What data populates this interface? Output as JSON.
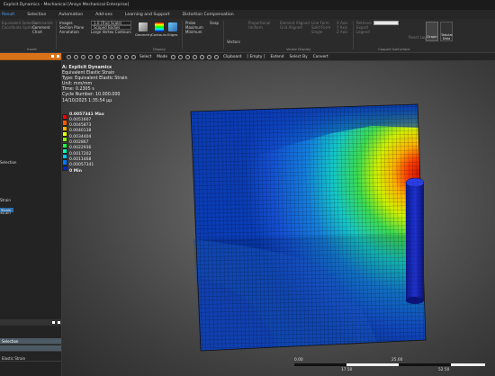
{
  "window": {
    "title": "Explicit Dynamics - Mechanical [Ansys Mechanical Enterprise]"
  },
  "menu": [
    "Result",
    "Selection",
    "Automation",
    "Add-ons",
    "Learning and Support",
    "Distortion Compensation"
  ],
  "ribbon": {
    "insert_group": [
      "Equivalent Selection",
      "Coordinate System",
      "Commands",
      "Comment",
      "Chart",
      "Annotation"
    ],
    "insert_label": "Insert",
    "image_label": "Images",
    "section_plane_label": "Section Plane",
    "scale_value": "1.0 (True Scale)",
    "scoped_bodies_value": "Scoped Bodies",
    "large_vertex_label": "Large Vertex Contours",
    "geometry_label": "Geometry",
    "contours_label": "Contours",
    "edges_label": "Edges",
    "display_label": "Display",
    "probe_label": "Probe",
    "maximum_label": "Maximum",
    "minimum_label": "Minimum",
    "snap_label": "Snap",
    "vectors_label": "Vectors",
    "proportional_label": "Proportional",
    "uniform_label": "Uniform",
    "vector_display_label": "Vector Display",
    "element_aligned_label": "Element Aligned",
    "grid_aligned_label": "Grid Aligned",
    "line_form_label": "Line Form",
    "solid_form_label": "Solid Form",
    "single_label": "Single",
    "axis_x": "X Axis",
    "axis_y": "Y Axis",
    "axis_z": "Z Axis",
    "retrieve_label": "Retrieve",
    "export_label": "Export",
    "legend_label": "Legend",
    "capped_isosurface_label": "Capped IsoSurface",
    "graph_label": "Graph",
    "tabular_label": "Tabular Data",
    "reset_label": "Reset Layout"
  },
  "toolbar": {
    "select_label": "Select",
    "mode_label": "Mode",
    "clipboard_label": "Clipboard",
    "empty_label": "[ Empty ]",
    "extend_label": "Extend",
    "select_by_label": "Select By",
    "convert_label": "Convert"
  },
  "tree": {
    "items": [
      "Selection",
      "Strain",
      "Strain"
    ],
    "selected_badge": "Strain"
  },
  "details": {
    "rows": [
      "Selection",
      "",
      "Elastic Strain"
    ]
  },
  "result": {
    "title": "A: Explicit Dynamics",
    "type_name": "Equivalent Elastic Strain",
    "type": "Type: Equivalent Elastic Strain",
    "unit": "Unit: mm/mm",
    "time": "Time: 0.2305 s",
    "cycle": "Cycle Number: 10.000.000",
    "date": "14/10/2025 1:35:54 μμ"
  },
  "legend": {
    "labels": [
      "0.0057341 Max",
      "0.0051607",
      "0.0045873",
      "0.0040138",
      "0.0034404",
      "0.002867",
      "0.0022936",
      "0.0017202",
      "0.0011468",
      "0.00057341",
      "0 Min"
    ],
    "colors": [
      "#ff0000",
      "#ff5a00",
      "#ffb400",
      "#e6ff00",
      "#8cff00",
      "#1eff3c",
      "#00ffb4",
      "#00c8ff",
      "#0078ff",
      "#0028c8"
    ]
  },
  "scale": {
    "ticks_top": [
      "0.00",
      "25.00"
    ],
    "ticks_bottom": [
      "17.50",
      "52.50"
    ]
  }
}
